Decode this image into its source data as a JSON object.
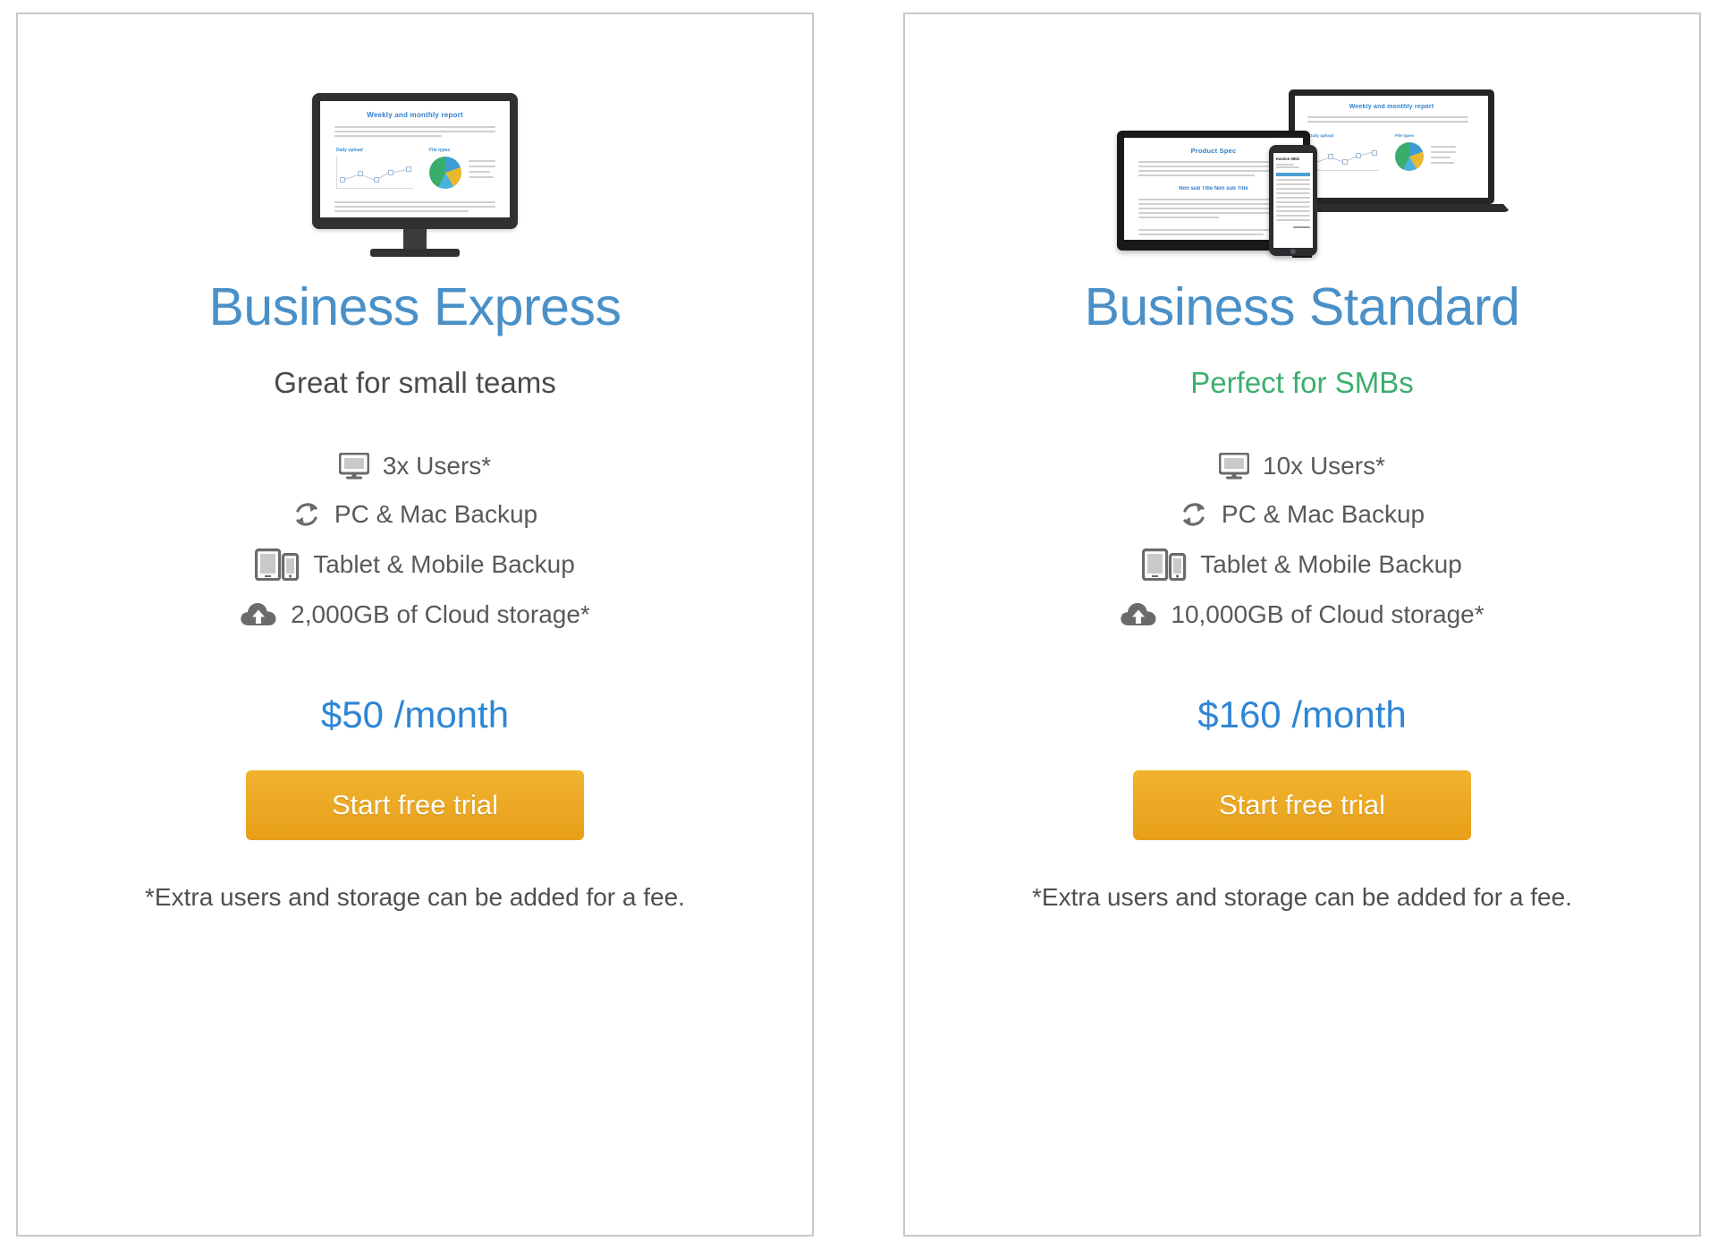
{
  "plans": [
    {
      "title": "Business Express",
      "subtitle": "Great for small teams",
      "subtitle_color": "#4a4a4a",
      "price": "$50 /month",
      "cta_label": "Start free trial",
      "footnote": "*Extra users and storage can be added for a fee.",
      "features": [
        {
          "icon": "monitor-icon",
          "label": "3x Users*"
        },
        {
          "icon": "sync-icon",
          "label": "PC & Mac Backup"
        },
        {
          "icon": "tablet-mobile-icon",
          "label": "Tablet & Mobile Backup"
        },
        {
          "icon": "cloud-upload-icon",
          "label": "2,000GB of Cloud storage*"
        }
      ],
      "illustration": {
        "type": "desktop-monitor",
        "screen_document": {
          "title": "Weekly and monthly report",
          "chart_labels": [
            "Daily upload",
            "File types"
          ]
        }
      }
    },
    {
      "title": "Business Standard",
      "subtitle": "Perfect for SMBs",
      "subtitle_color": "#3cae6f",
      "price": "$160 /month",
      "cta_label": "Start free trial",
      "footnote": "*Extra users and storage can be added for a fee.",
      "features": [
        {
          "icon": "monitor-icon",
          "label": "10x Users*"
        },
        {
          "icon": "sync-icon",
          "label": "PC & Mac Backup"
        },
        {
          "icon": "tablet-mobile-icon",
          "label": "Tablet & Mobile Backup"
        },
        {
          "icon": "cloud-upload-icon",
          "label": "10,000GB of Cloud storage*"
        }
      ],
      "illustration": {
        "type": "multi-device",
        "monitor_document": {
          "title": "Product Spec",
          "section_heading": "Non sub Title Non sub Title"
        },
        "laptop_document": {
          "title": "Weekly and monthly report",
          "chart_labels": [
            "Daily upload",
            "File types"
          ]
        },
        "phone_document": {
          "title": "Invoice 0001"
        }
      }
    }
  ],
  "colors": {
    "title_blue": "#4a90c7",
    "price_blue": "#2e86d4",
    "accent_green": "#3cae6f",
    "cta_orange": "#eca824",
    "card_border": "#c8c8c8",
    "body_text": "#595959"
  }
}
